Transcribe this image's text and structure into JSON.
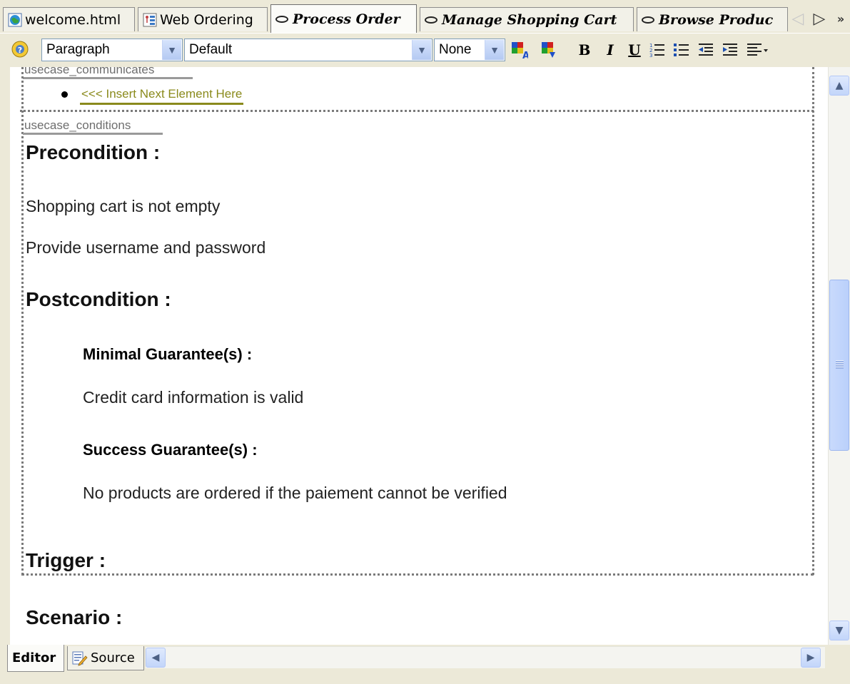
{
  "tabs": [
    {
      "label": "welcome.html",
      "icon": "html-file-icon"
    },
    {
      "label": "Web Ordering",
      "icon": "diagram-icon"
    },
    {
      "label": "Process Order",
      "icon": "usecase-oval-icon",
      "active": true
    },
    {
      "label": "Manage Shopping Cart",
      "icon": "usecase-oval-icon"
    },
    {
      "label": "Browse Produc",
      "icon": "usecase-oval-icon"
    }
  ],
  "toolbar": {
    "block_format": "Paragraph",
    "font": "Default",
    "size": "None",
    "bold": "B",
    "italic": "I",
    "underline": "U"
  },
  "content": {
    "communicates_label": "usecase_communicates",
    "insert_hint": "<<< Insert Next Element Here",
    "conditions_label": "usecase_conditions",
    "precondition_heading": "Precondition :",
    "preconditions": [
      "Shopping cart is not empty",
      "Provide username and password"
    ],
    "postcondition_heading": "Postcondition :",
    "minimal_heading": "Minimal Guarantee(s) :",
    "minimal_text": "Credit card information is valid",
    "success_heading": "Success Guarantee(s) :",
    "success_text": "No products are ordered if the paiement cannot be verified",
    "trigger_heading": "Trigger :",
    "scenario_heading": "Scenario :"
  },
  "bottom_tabs": [
    {
      "label": "Editor",
      "active": true
    },
    {
      "label": "Source",
      "icon": "source-pencil-icon"
    }
  ],
  "colors": {
    "insert_hint": "#8a8a1c",
    "section_label": "#6e6e6e",
    "scrollbar_thumb": "#bad0fb"
  }
}
